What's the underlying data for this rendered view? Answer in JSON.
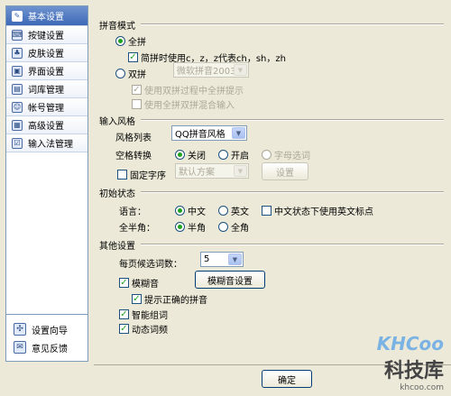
{
  "sidebar": {
    "items": [
      {
        "label": "基本设置",
        "icon": "wrench-icon",
        "glyph": "✎"
      },
      {
        "label": "按键设置",
        "icon": "keyboard-icon",
        "glyph": "⌨"
      },
      {
        "label": "皮肤设置",
        "icon": "skin-icon",
        "glyph": "♣"
      },
      {
        "label": "界面设置",
        "icon": "window-icon",
        "glyph": "▣"
      },
      {
        "label": "词库管理",
        "icon": "dictionary-icon",
        "glyph": "▤"
      },
      {
        "label": "帐号管理",
        "icon": "account-icon",
        "glyph": "☺"
      },
      {
        "label": "高级设置",
        "icon": "advanced-icon",
        "glyph": "▦"
      },
      {
        "label": "输入法管理",
        "icon": "ime-icon",
        "glyph": "☑"
      }
    ],
    "bottom": [
      {
        "label": "设置向导",
        "icon": "wizard-icon",
        "glyph": "✣"
      },
      {
        "label": "意见反馈",
        "icon": "feedback-icon",
        "glyph": "✉"
      }
    ]
  },
  "pinyin": {
    "title": "拼音模式",
    "full": "全拼",
    "abbrev": "简拼时使用c，z，z代表ch，sh，zh",
    "double": "双拼",
    "double_scheme": "微软拼音2003",
    "double_hint": "使用双拼过程中全拼提示",
    "double_mix": "使用全拼双拼混合输入"
  },
  "style": {
    "title": "输入风格",
    "list_label": "风格列表",
    "list_value": "QQ拼音风格",
    "space_label": "空格转换",
    "off": "关闭",
    "on": "开启",
    "word_select": "字母选词",
    "fixed_pos": "固定字序",
    "fixed_scheme": "默认方案",
    "settings": "设置"
  },
  "init": {
    "title": "初始状态",
    "lang_label": "语言：",
    "chinese": "中文",
    "english": "英文",
    "eng_punct": "中文状态下使用英文标点",
    "width_label": "全半角：",
    "half": "半角",
    "full": "全角"
  },
  "other": {
    "title": "其他设置",
    "per_page_label": "每页候选词数：",
    "per_page_value": "5",
    "fuzzy": "模糊音",
    "fuzzy_settings": "模糊音设置",
    "fuzzy_hint": "提示正确的拼音",
    "smart": "智能组词",
    "dynamic": "动态词频"
  },
  "footer": {
    "ok": "确定"
  },
  "watermark": {
    "logo": "KHCoo",
    "cn": "科技库",
    "url": "khcoo.com"
  }
}
